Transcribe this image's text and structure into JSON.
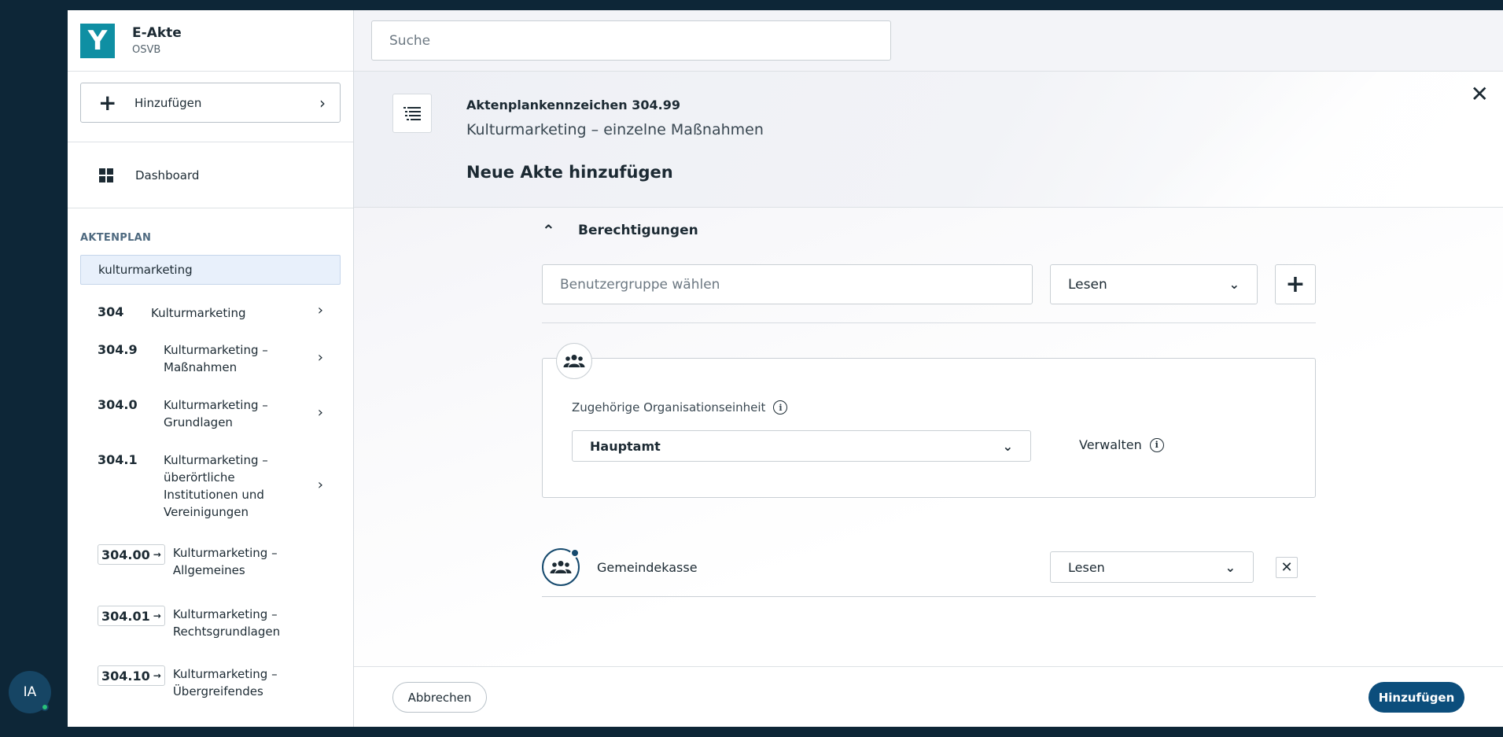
{
  "user": {
    "initials": "IA"
  },
  "sidebar": {
    "app_title": "E-Akte",
    "app_subtitle": "OSVB",
    "logo_letter": "Y",
    "add_label": "Hinzufügen",
    "dashboard_label": "Dashboard",
    "plan_heading": "AKTENPLAN",
    "plan_search_value": "kulturmarketing",
    "tree": [
      {
        "code": "304",
        "label": "Kulturmarketing"
      },
      {
        "code": "304.9",
        "label": "Kulturmarketing – Maßnahmen"
      },
      {
        "code": "304.0",
        "label": "Kulturmarketing – Grundlagen"
      },
      {
        "code": "304.1",
        "label": "Kulturmarketing – überörtliche Institutionen und Vereinigungen"
      },
      {
        "code": "304.00",
        "label": "Kulturmarketing – Allgemeines"
      },
      {
        "code": "304.01",
        "label": "Kulturmarketing – Rechtsgrundlagen"
      },
      {
        "code": "304.10",
        "label": "Kulturmarketing – Übergreifendes"
      }
    ]
  },
  "topbar": {
    "search_placeholder": "Suche"
  },
  "header": {
    "code": "Aktenplankennzeichen 304.99",
    "name": "Kulturmarketing – einzelne Maßnahmen",
    "title": "Neue Akte hinzufügen"
  },
  "permissions": {
    "section_title": "Berechtigungen",
    "group_placeholder": "Benutzergruppe wählen",
    "permission_value": "Lesen",
    "org_label": "Zugehörige Organisationseinheit",
    "org_value": "Hauptamt",
    "manage_label": "Verwalten",
    "members": [
      {
        "name": "Gemeindekasse",
        "permission": "Lesen"
      }
    ]
  },
  "footer": {
    "cancel_label": "Abbrechen",
    "submit_label": "Hinzufügen"
  },
  "colors": {
    "brand_teal": "#0f8fa3",
    "primary": "#0c4e7c",
    "background_dark": "#0d2637",
    "online_status": "#29c27a"
  },
  "icons": [
    "plus-icon",
    "chevron-right-icon",
    "dashboard-icon",
    "list-menu-icon",
    "close-icon",
    "chevron-up-icon",
    "chevron-down-icon",
    "group-icon",
    "info-icon",
    "arrow-right-icon"
  ]
}
